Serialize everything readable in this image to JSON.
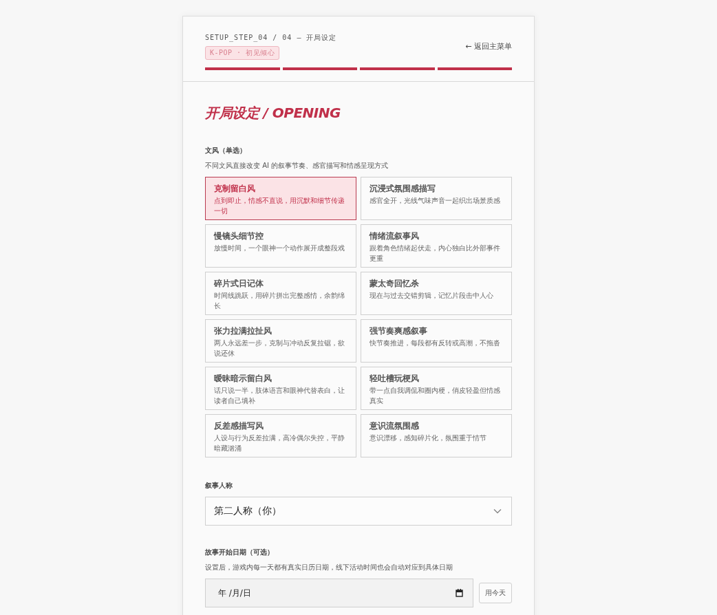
{
  "header": {
    "step": "SETUP_STEP_04 / 04 — 开局设定",
    "tag": "K-POP · 初见倾心",
    "back_link": "← 返回主菜单",
    "progress": [
      {
        "done": true
      },
      {
        "done": true
      },
      {
        "done": true
      },
      {
        "done": true
      }
    ]
  },
  "title": "开局设定 / OPENING",
  "style_section": {
    "label": "文风（单选）",
    "hint": "不同文风直接改变 AI 的叙事节奏、感官描写和情感呈现方式",
    "options": [
      {
        "name": "克制留白风",
        "desc": "点到即止，情感不直说，用沉默和细节传递一切",
        "selected": true
      },
      {
        "name": "沉浸式氛围感描写",
        "desc": "感官全开，光线气味声音一起织出场景质感",
        "selected": false
      },
      {
        "name": "慢镜头细节控",
        "desc": "放慢时间，一个眼神一个动作展开成整段戏",
        "selected": false
      },
      {
        "name": "情绪流叙事风",
        "desc": "跟着角色情绪起伏走，内心独白比外部事件更重",
        "selected": false
      },
      {
        "name": "碎片式日记体",
        "desc": "时间线跳跃，用碎片拼出完整感情，余韵绵长",
        "selected": false
      },
      {
        "name": "蒙太奇回忆杀",
        "desc": "现在与过去交错剪辑，记忆片段击中人心",
        "selected": false
      },
      {
        "name": "张力拉满拉扯风",
        "desc": "两人永远差一步，克制与冲动反复拉锯，欲说还休",
        "selected": false
      },
      {
        "name": "强节奏爽感叙事",
        "desc": "快节奏推进，每段都有反转或高潮，不拖沓",
        "selected": false
      },
      {
        "name": "暧昧暗示留白风",
        "desc": "话只说一半，肢体语言和眼神代替表白，让读者自己填补",
        "selected": false
      },
      {
        "name": "轻吐槽玩梗风",
        "desc": "带一点自我调侃和圈内梗，俏皮轻盈但情感真实",
        "selected": false
      },
      {
        "name": "反差感描写风",
        "desc": "人设与行为反差拉满，高冷偶尔失控，平静暗藏汹涌",
        "selected": false
      },
      {
        "name": "意识流氛围感",
        "desc": "意识漂移，感知碎片化，氛围重于情节",
        "selected": false
      }
    ]
  },
  "narration": {
    "label": "叙事人称",
    "value": "第二人称（你）"
  },
  "start_date": {
    "label": "故事开始日期（可选）",
    "hint": "设置后，游戏内每一天都有真实日历日期，线下活动时间也会自动对应到具体日期",
    "placeholder": "年 /月/日",
    "today_button": "用今天"
  }
}
